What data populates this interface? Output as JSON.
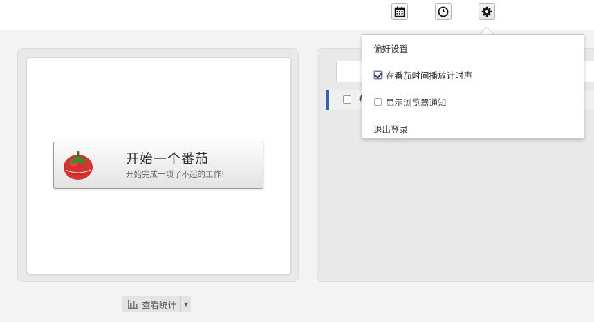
{
  "topbar": {
    "icons": [
      "calendar-icon",
      "clock-icon",
      "gear-icon"
    ]
  },
  "pomodoro": {
    "start_title": "开始一个番茄",
    "start_subtitle": "开始完成一项了不起的工作!",
    "icon": "tomato-icon",
    "tomato_color": "#d9312f"
  },
  "tasks": {
    "row_text": "#",
    "row_accent": "#3b5fa8"
  },
  "stats": {
    "label": "查看统计",
    "icon": "bar-chart-icon"
  },
  "settings_menu": {
    "header": "偏好设置",
    "items": [
      {
        "label": "在番茄时间播放计时声",
        "checked": true
      },
      {
        "label": "显示浏览器通知",
        "checked": false
      }
    ],
    "logout": "退出登录"
  }
}
